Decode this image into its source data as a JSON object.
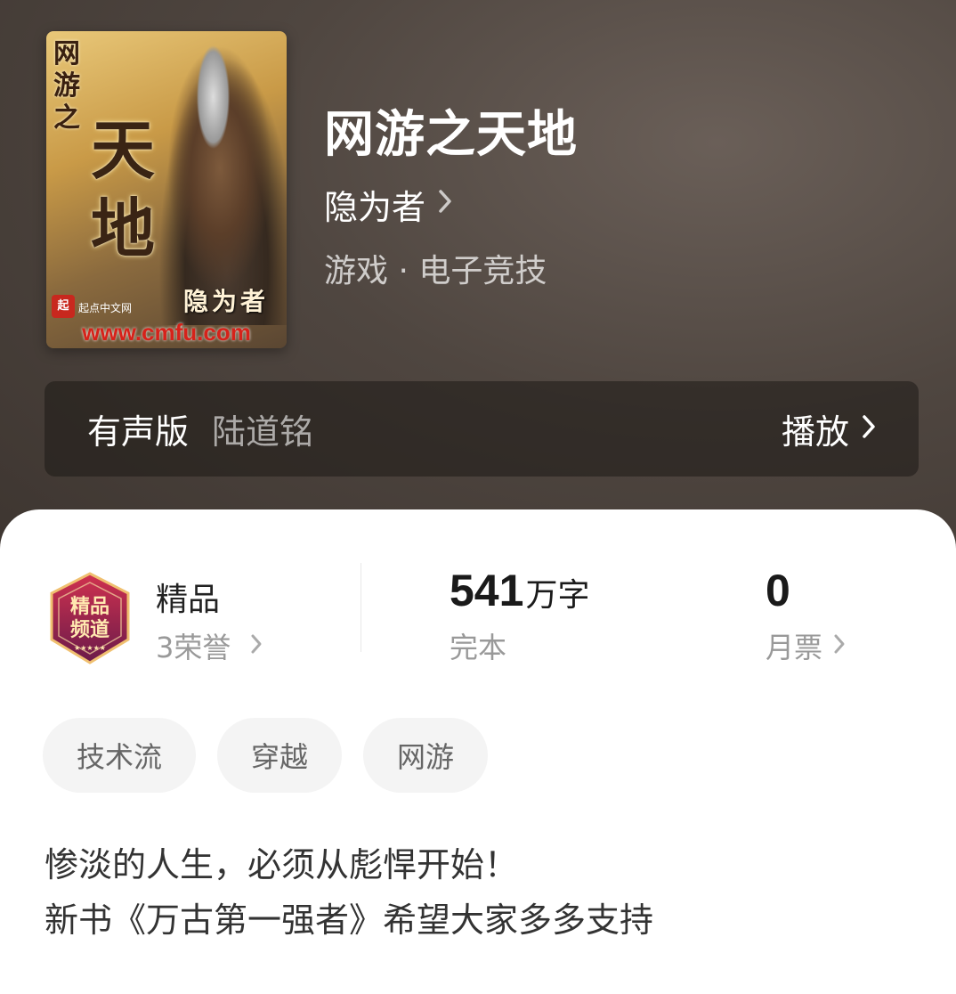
{
  "book": {
    "cover": {
      "side_text": "网游之",
      "big_text": "天地",
      "author_text": "隐为者",
      "logo_text": "起点中文网",
      "url": "www.cmfu.com"
    },
    "title": "网游之天地",
    "author": "隐为者",
    "genre": "游戏 · 电子竞技"
  },
  "audio": {
    "label": "有声版",
    "narrator": "陆道铭",
    "play_label": "播放"
  },
  "stats": {
    "quality_title": "精品",
    "quality_honors": "3荣誉",
    "badge_text": "精品频道",
    "word_count": "541",
    "word_unit": "万字",
    "status": "完本",
    "monthly_votes": "0",
    "monthly_votes_label": "月票"
  },
  "tags": [
    "技术流",
    "穿越",
    "网游"
  ],
  "description": {
    "line1": "惨淡的人生，必须从彪悍开始！",
    "line2": "新书《万古第一强者》希望大家多多支持"
  },
  "colors": {
    "hero_bg": "#4f4640",
    "tag_bg": "#f4f4f4",
    "badge_main": "#8e1c4a"
  }
}
